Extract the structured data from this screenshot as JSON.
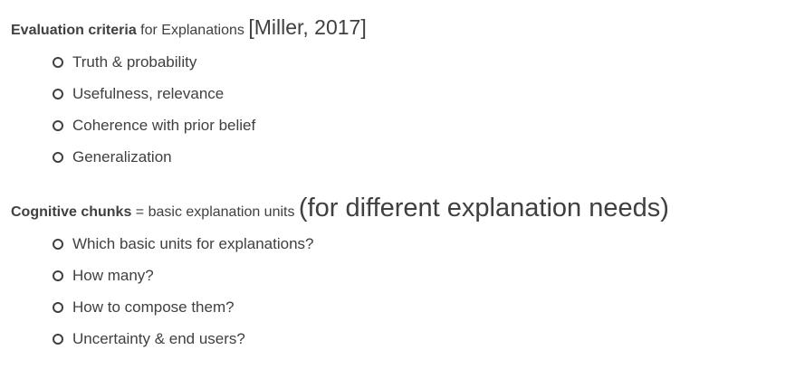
{
  "sections": [
    {
      "heading": {
        "bold": "Evaluation criteria",
        "normal": " for Explanations ",
        "large": "[Miller, 2017]"
      },
      "items": [
        "Truth & probability",
        "Usefulness, relevance",
        "Coherence with prior belief",
        "Generalization"
      ]
    },
    {
      "heading": {
        "bold": "Cognitive chunks",
        "normal": " = basic explanation units ",
        "large": "(for different explanation needs)"
      },
      "items": [
        "Which basic units for explanations?",
        "How many?",
        "How to compose them?",
        "Uncertainty & end users?"
      ]
    }
  ],
  "icons": {
    "bullet": "hollow-circle-icon"
  },
  "colors": {
    "text": "#404040",
    "background": "#ffffff"
  }
}
